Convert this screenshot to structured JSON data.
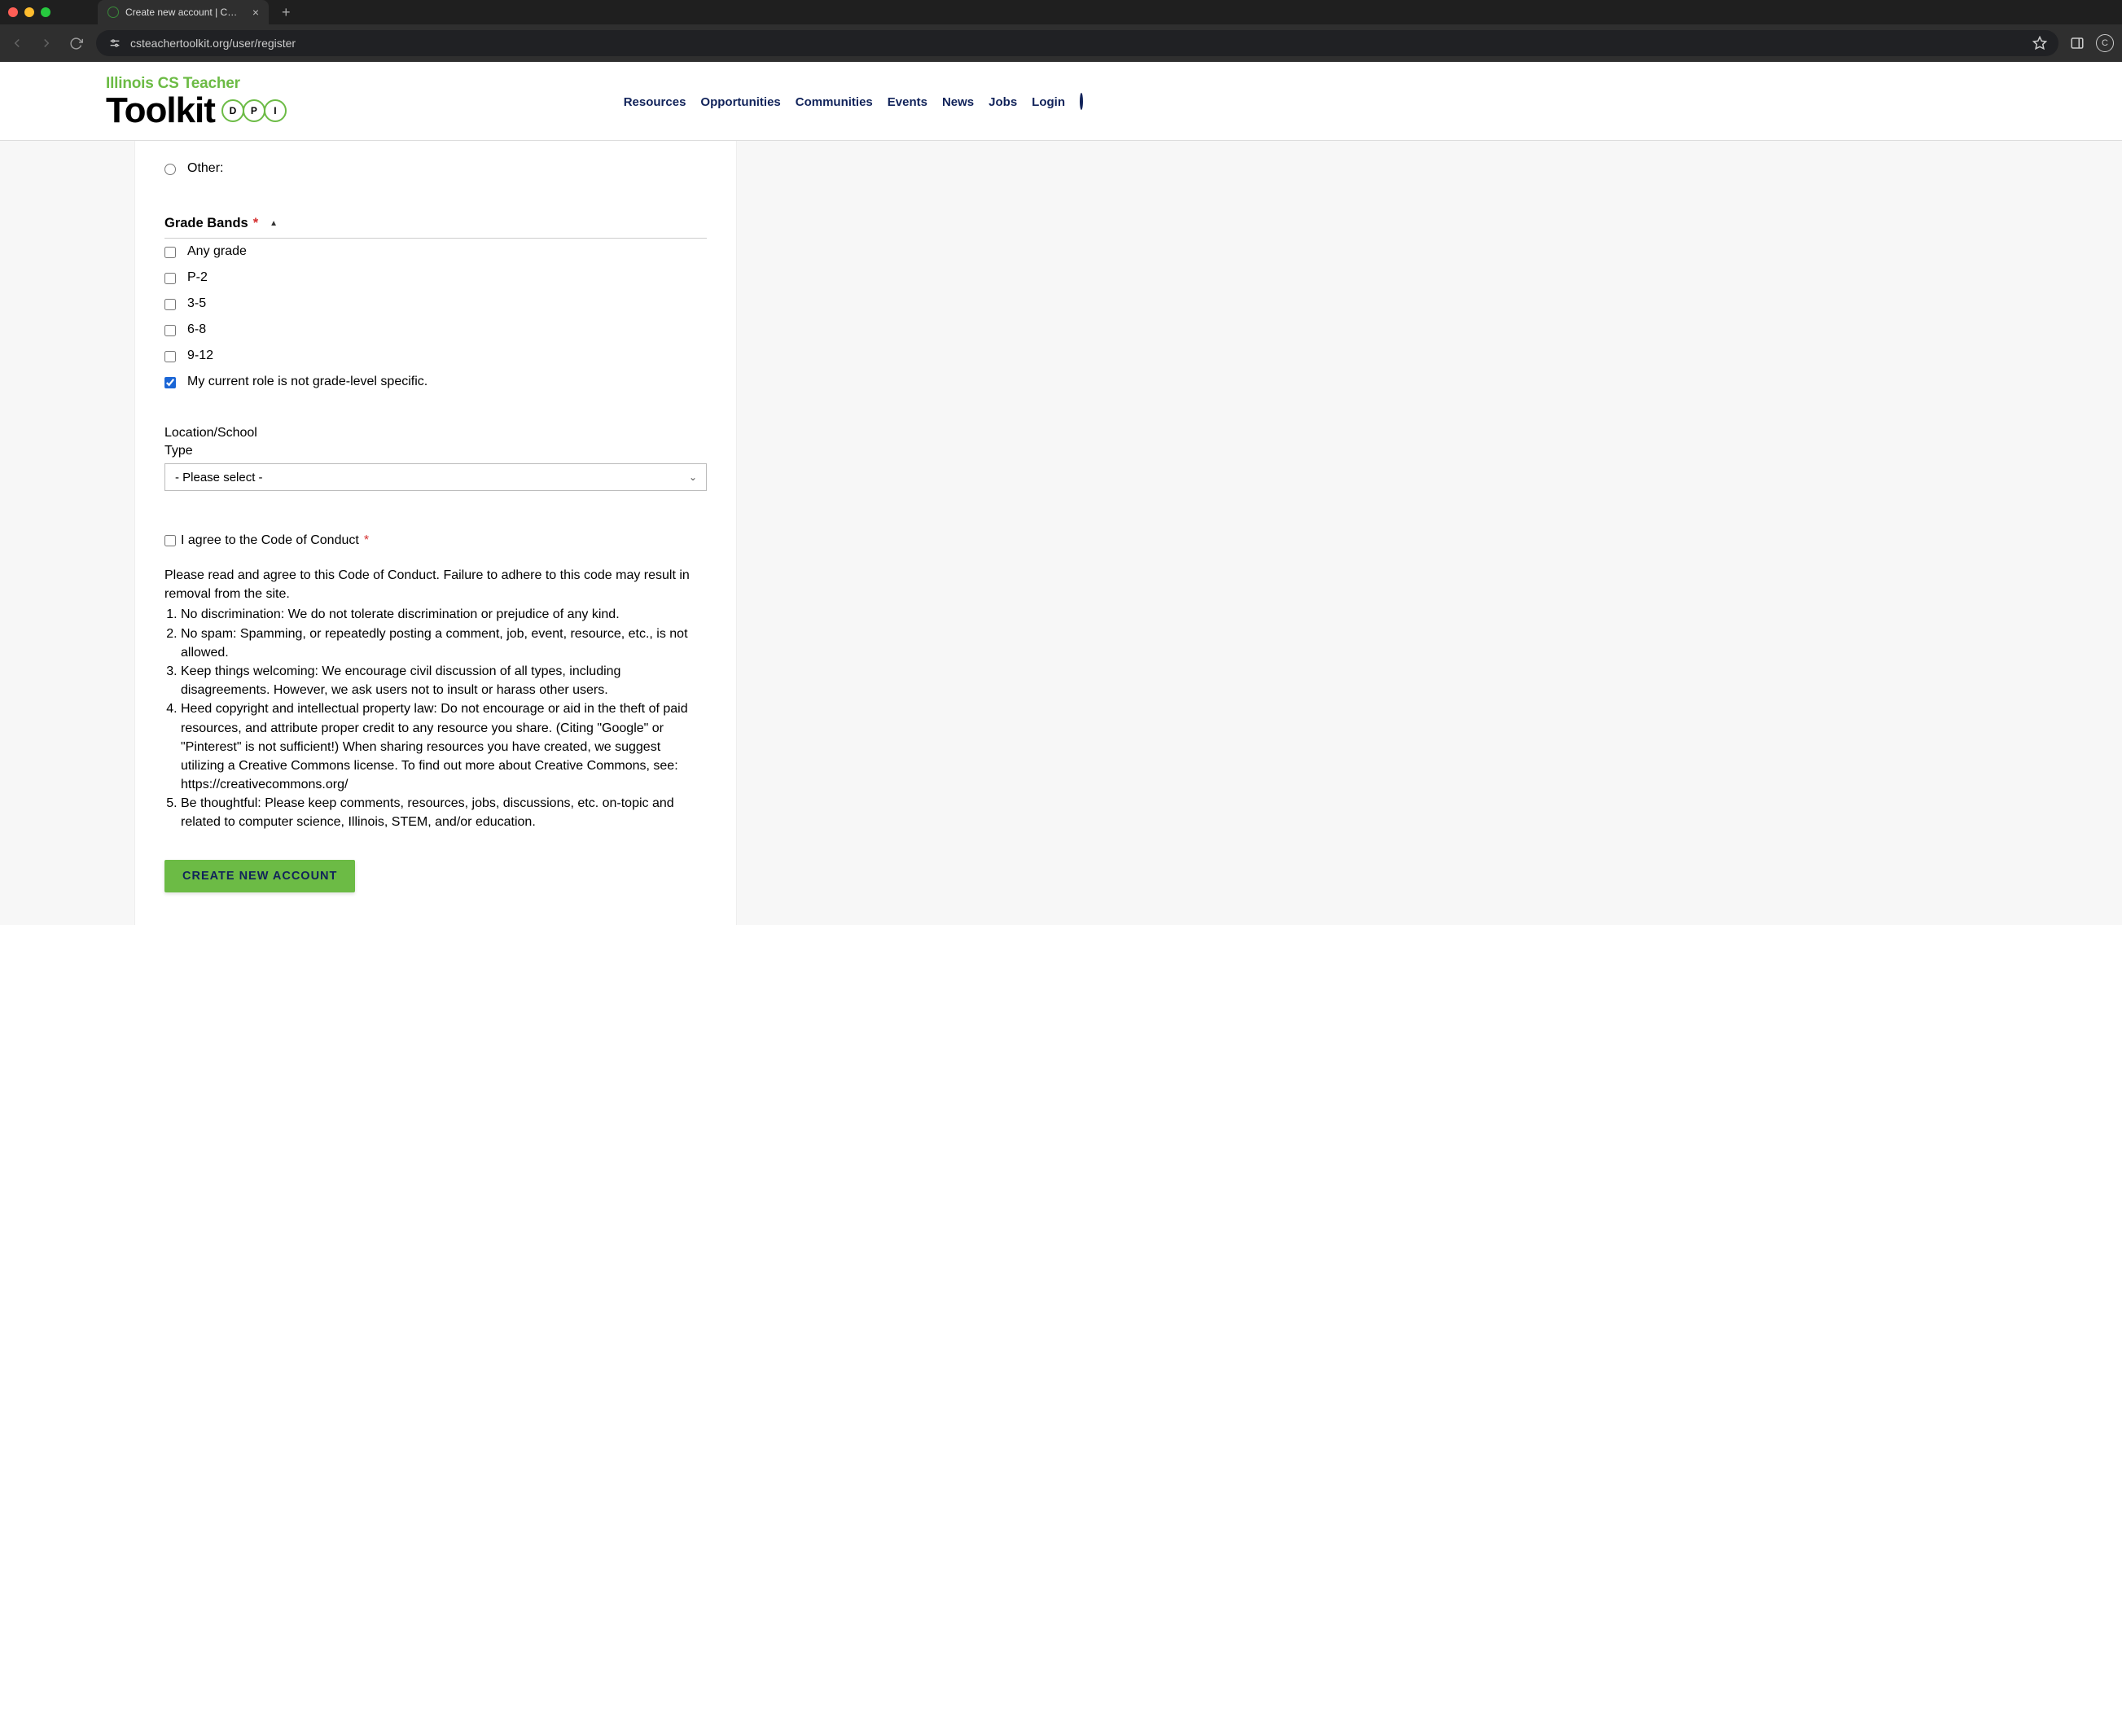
{
  "browser": {
    "tab_title": "Create new account | CS Teac",
    "url": "csteachertoolkit.org/user/register"
  },
  "header": {
    "logo_sub": "Illinois CS Teacher",
    "logo_word": "Toolkit",
    "logo_letters": [
      "D",
      "P",
      "I"
    ],
    "nav": [
      "Resources",
      "Opportunities",
      "Communities",
      "Events",
      "News",
      "Jobs",
      "Login"
    ]
  },
  "form": {
    "other_option": "Other:",
    "grade_bands_title": "Grade Bands",
    "grade_bands": [
      {
        "label": "Any grade",
        "checked": false
      },
      {
        "label": "P-2",
        "checked": false
      },
      {
        "label": "3-5",
        "checked": false
      },
      {
        "label": "6-8",
        "checked": false
      },
      {
        "label": "9-12",
        "checked": false
      },
      {
        "label": "My current role is not grade-level specific.",
        "checked": true
      }
    ],
    "location_label": "Location/School",
    "type_label": "Type",
    "type_placeholder": "- Please select -",
    "coc_label": "I agree to the Code of Conduct",
    "coc_intro": "Please read and agree to this Code of Conduct. Failure to adhere to this code may result in removal from the site.",
    "coc_rules": [
      "No discrimination: We do not tolerate discrimination or prejudice of any kind.",
      "No spam: Spamming, or repeatedly posting a comment, job, event, resource, etc., is not allowed.",
      "Keep things welcoming: We encourage civil discussion of all types, including disagreements. However, we ask users not to insult or harass other users.",
      "Heed copyright and intellectual property law: Do not encourage or aid in the theft of paid resources, and attribute proper credit to any resource you share. (Citing \"Google\" or \"Pinterest\" is not sufficient!) When sharing resources you have created, we suggest utilizing a Creative Commons license. To find out more about Creative Commons, see: https://creativecommons.org/",
      "Be thoughtful: Please keep comments, resources, jobs, discussions, etc. on-topic and related to computer science, Illinois, STEM, and/or education."
    ],
    "submit_label": "CREATE NEW ACCOUNT"
  }
}
